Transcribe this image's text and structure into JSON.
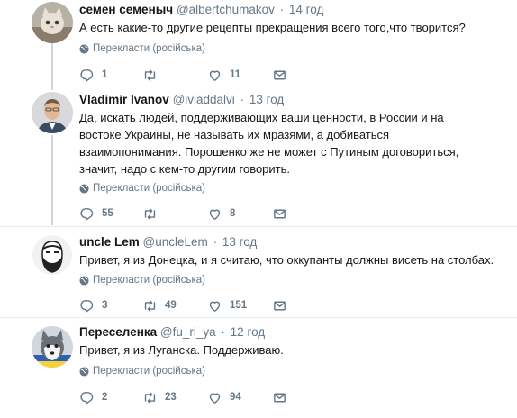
{
  "tweets": [
    {
      "name": "семен семеныч",
      "handle": "@albertchumakov",
      "time": "14 год",
      "text": "А есть какие-то другие рецепты прекращения всего того,что творится?",
      "translate": "Перекласти (російська)",
      "replies": "1",
      "retweets": "",
      "likes": "11"
    },
    {
      "name": "Vladimir Ivanov",
      "handle": "@ivladdalvi",
      "time": "13 год",
      "text": "Да, искать людей, поддерживающих ваши ценности, в России и на востоке Украины, не называть их мразями, а добиваться взаимопонимания. Порошенко же не может с Путиным договориться, значит, надо с кем-то другим говорить.",
      "translate": "Перекласти (російська)",
      "replies": "55",
      "retweets": "",
      "likes": "8"
    },
    {
      "name": "uncle Lem",
      "handle": "@uncleLem",
      "time": "13 год",
      "text": "Привет, я из Донецка, и я считаю, что оккупанты должны висеть на столбах.",
      "translate": "Перекласти (російська)",
      "replies": "3",
      "retweets": "49",
      "likes": "151"
    },
    {
      "name": "Переселенка",
      "handle": "@fu_ri_ya",
      "time": "12 год",
      "text": "Привет, я из Луганска. Поддерживаю.",
      "translate": "Перекласти (російська)",
      "replies": "2",
      "retweets": "23",
      "likes": "94"
    }
  ],
  "separator": "·",
  "icons": {
    "reply": "reply-icon",
    "retweet": "retweet-icon",
    "like": "heart-icon",
    "dm": "envelope-icon",
    "translate": "globe-icon"
  },
  "colors": {
    "text": "#14171a",
    "secondary": "#657786",
    "thread_line": "#ccd6dd",
    "divider": "#e6ecf0"
  }
}
